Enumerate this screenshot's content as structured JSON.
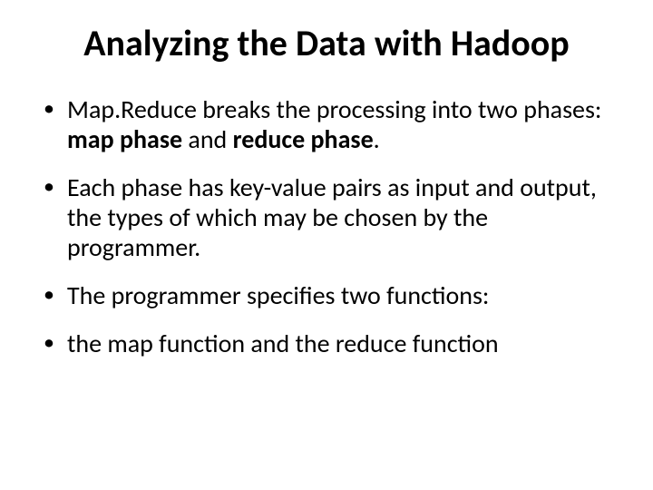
{
  "title": "Analyzing the Data with Hadoop",
  "bullets": {
    "b1a": "Map.Reduce breaks the processing into two phases: ",
    "b1b": "map phase",
    "b1c": " and ",
    "b1d": "reduce phase",
    "b1e": ".",
    "b2": "Each phase has key-value pairs as input and output, the types of which may be chosen by the programmer.",
    "b3": "The programmer specifies two functions:",
    "b4": "the map function and the reduce function"
  }
}
